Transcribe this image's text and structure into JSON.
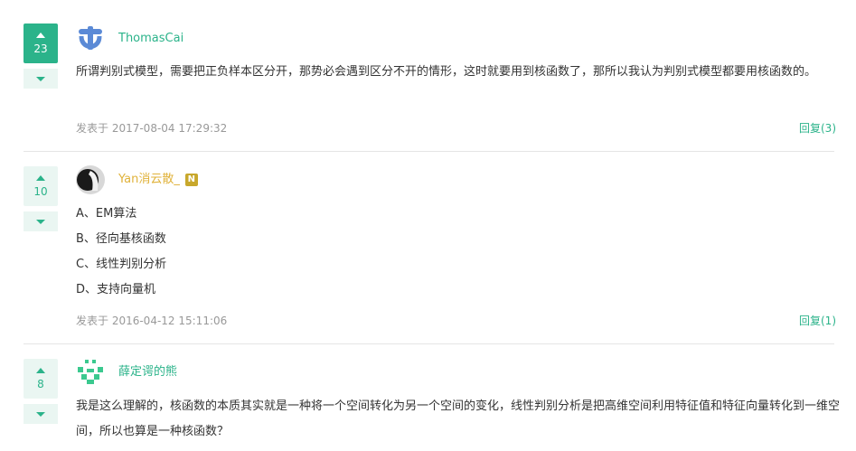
{
  "posts": [
    {
      "votes": "23",
      "author": "ThomasCai",
      "author_color": "#2bb38a",
      "text": "所谓判别式模型，需要把正负样本区分开，那势必会遇到区分不开的情形，这时就要用到核函数了，那所以我认为判别式模型都要用核函数的。",
      "time": "发表于 2017-08-04 17:29:32",
      "reply": "回复(3)"
    },
    {
      "votes": "10",
      "author": "Yan消云散_",
      "author_color": "#e0b23a",
      "badge": "N",
      "options": [
        "A、EM算法",
        "B、径向基核函数",
        "C、线性判别分析",
        "D、支持向量机"
      ],
      "time": "发表于 2016-04-12 15:11:06",
      "reply": "回复(1)"
    },
    {
      "votes": "8",
      "author": "薛定谔的熊",
      "author_color": "#2bb38a",
      "text": "我是这么理解的，核函数的本质其实就是一种将一个空间转化为另一个空间的变化，线性判别分析是把高维空间利用特征值和特征向量转化到一维空间，所以也算是一种核函数？"
    }
  ]
}
